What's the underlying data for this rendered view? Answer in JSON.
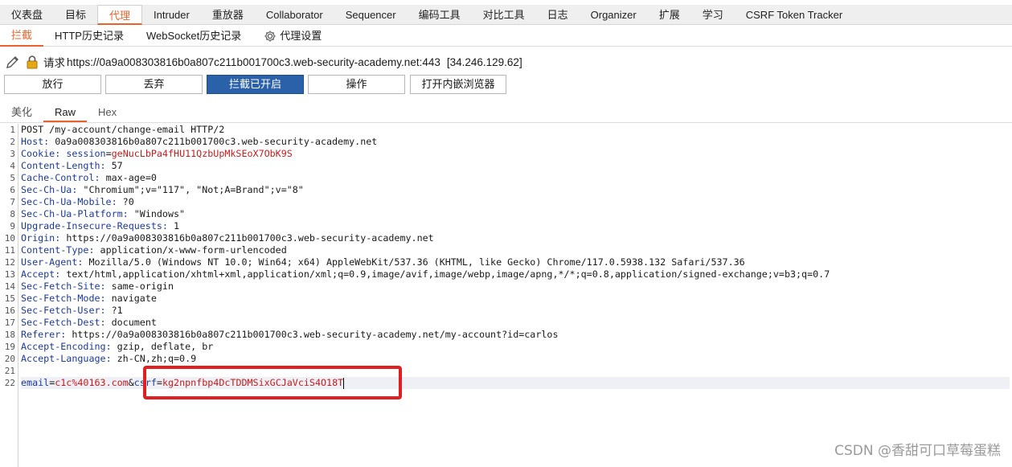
{
  "top_tabs": [
    "仪表盘",
    "目标",
    "代理",
    "Intruder",
    "重放器",
    "Collaborator",
    "Sequencer",
    "编码工具",
    "对比工具",
    "日志",
    "Organizer",
    "扩展",
    "学习",
    "CSRF Token Tracker"
  ],
  "sub_tabs": [
    "拦截",
    "HTTP历史记录",
    "WebSocket历史记录",
    "代理设置"
  ],
  "request_info": {
    "prefix": "请求",
    "url": "https://0a9a008303816b0a807c211b001700c3.web-security-academy.net:443",
    "ip": "[34.246.129.62]"
  },
  "buttons": {
    "forward": "放行",
    "drop": "丢弃",
    "intercept_on": "拦截已开启",
    "action": "操作",
    "open_browser": "打开内嵌浏览器"
  },
  "view_tabs": [
    "美化",
    "Raw",
    "Hex"
  ],
  "request": {
    "request_line": "POST /my-account/change-email HTTP/2",
    "headers": [
      {
        "name": "Host",
        "value": "0a9a008303816b0a807c211b001700c3.web-security-academy.net"
      },
      {
        "name": "Cookie",
        "cookie_name": "session",
        "cookie_value": "geNucLbPa4fHU11QzbUpMkSEoX7ObK9S"
      },
      {
        "name": "Content-Length",
        "value": "57"
      },
      {
        "name": "Cache-Control",
        "value": "max-age=0"
      },
      {
        "name": "Sec-Ch-Ua",
        "value": "\"Chromium\";v=\"117\", \"Not;A=Brand\";v=\"8\""
      },
      {
        "name": "Sec-Ch-Ua-Mobile",
        "value": "?0"
      },
      {
        "name": "Sec-Ch-Ua-Platform",
        "value": "\"Windows\""
      },
      {
        "name": "Upgrade-Insecure-Requests",
        "value": "1"
      },
      {
        "name": "Origin",
        "value": "https://0a9a008303816b0a807c211b001700c3.web-security-academy.net"
      },
      {
        "name": "Content-Type",
        "value": "application/x-www-form-urlencoded"
      },
      {
        "name": "User-Agent",
        "value": "Mozilla/5.0 (Windows NT 10.0; Win64; x64) AppleWebKit/537.36 (KHTML, like Gecko) Chrome/117.0.5938.132 Safari/537.36"
      },
      {
        "name": "Accept",
        "value": "text/html,application/xhtml+xml,application/xml;q=0.9,image/avif,image/webp,image/apng,*/*;q=0.8,application/signed-exchange;v=b3;q=0.7"
      },
      {
        "name": "Sec-Fetch-Site",
        "value": "same-origin"
      },
      {
        "name": "Sec-Fetch-Mode",
        "value": "navigate"
      },
      {
        "name": "Sec-Fetch-User",
        "value": "?1"
      },
      {
        "name": "Sec-Fetch-Dest",
        "value": "document"
      },
      {
        "name": "Referer",
        "value": "https://0a9a008303816b0a807c211b001700c3.web-security-academy.net/my-account?id=carlos"
      },
      {
        "name": "Accept-Encoding",
        "value": "gzip, deflate, br"
      },
      {
        "name": "Accept-Language",
        "value": "zh-CN,zh;q=0.9"
      }
    ],
    "body_params": [
      {
        "name": "email",
        "value": "c1c%40163.com"
      },
      {
        "name": "csrf",
        "value": "kg2npnfbp4DcTDDMSixGCJaVciS4O18T"
      }
    ]
  },
  "line_count": 22,
  "watermark": "CSDN @香甜可口草莓蛋糕",
  "colors": {
    "accent": "#e8632b",
    "primary_button": "#2b61a8",
    "highlight_box": "#e02020",
    "header_name": "#1c3a9c",
    "value_red": "#c81c1c"
  }
}
